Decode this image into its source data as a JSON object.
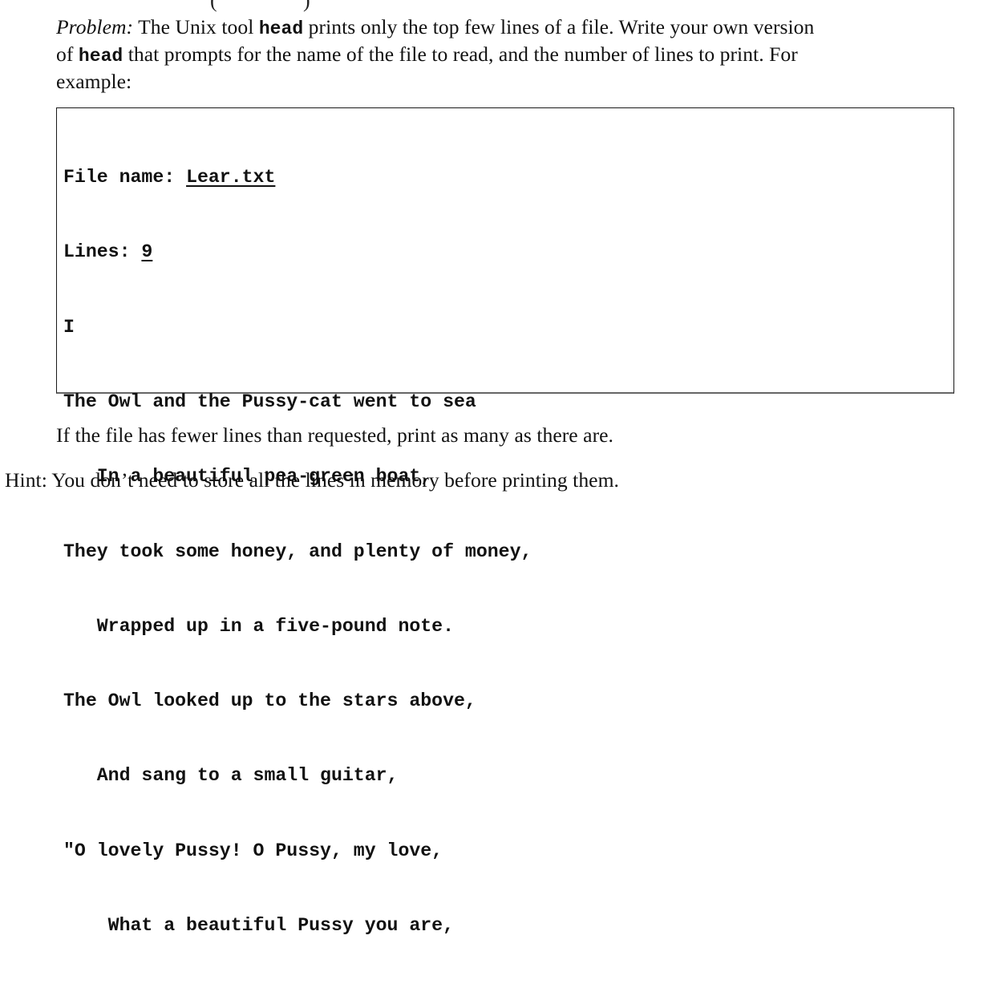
{
  "problem": {
    "label": "Problem:",
    "text_1": " The Unix tool ",
    "tool_name": "head",
    "text_2": " prints only the top few lines of a file.  Write your own version",
    "text_3": "of ",
    "tool_name_2": "head",
    "text_4": " that prompts for the name of the file to read, and the number of lines to print.  For",
    "text_5": "example:"
  },
  "example": {
    "file_prompt": "File name: ",
    "file_value": "Lear.txt",
    "lines_prompt": "Lines: ",
    "lines_value": "9",
    "output_lines": [
      "I",
      "The Owl and the Pussy-cat went to sea",
      "   In a beautiful pea-green boat,",
      "They took some honey, and plenty of money,",
      "   Wrapped up in a five-pound note.",
      "The Owl looked up to the stars above,",
      "   And sang to a small guitar,",
      "\"O lovely Pussy! O Pussy, my love,",
      "    What a beautiful Pussy you are,"
    ]
  },
  "note": "If the file has fewer lines than requested, print as many as there are.",
  "hint": "Hint: You don’t need to store all the lines in memory before printing them."
}
